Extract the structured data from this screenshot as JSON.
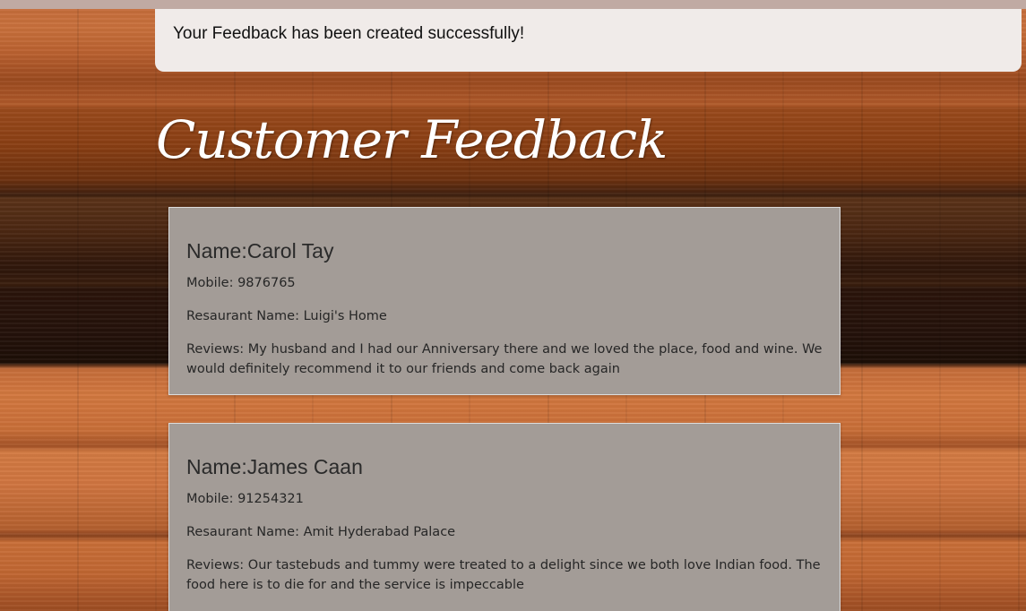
{
  "alert": {
    "message": "Your Feedback has been created successfully!"
  },
  "page": {
    "title": "Customer Feedback"
  },
  "labels": {
    "name": "Name:",
    "mobile": "Mobile: ",
    "restaurant": "Resaurant Name: ",
    "reviews": "Reviews: "
  },
  "feedback": [
    {
      "name": "Carol Tay",
      "mobile": "9876765",
      "restaurant": "Luigi's Home",
      "review": "My husband and I had our Anniversary there and we loved the place, food and wine. We would definitely recommend it to our friends and come back again"
    },
    {
      "name": "James Caan",
      "mobile": "91254321",
      "restaurant": "Amit Hyderabad Palace",
      "review": "Our tastebuds and tummy were treated to a delight since we both love Indian food. The food here is to die for and the service is impeccable"
    }
  ]
}
